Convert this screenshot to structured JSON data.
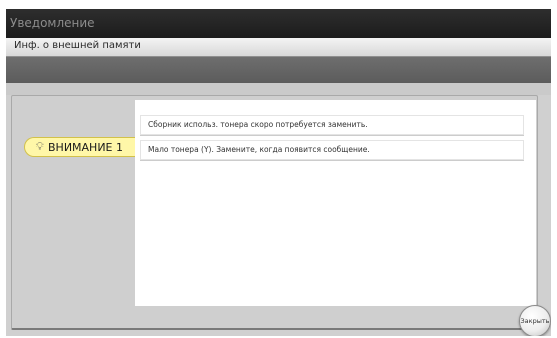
{
  "window": {
    "title": "Уведомление"
  },
  "header": {
    "subtitle": "Инф. о внешней памяти"
  },
  "alert": {
    "tab_label": "ВНИМАНИЕ 1",
    "tab_icon": "bulb-icon",
    "messages": [
      "Сборник использ. тонера скоро потребуется заменить.",
      "Мало тонера (Y). Замените, когда появится сообщение."
    ]
  },
  "buttons": {
    "close_label": "Закрыть"
  },
  "colors": {
    "titlebar": "#262626",
    "tab_background": "#fff7a8",
    "panel": "#cfcfcf"
  }
}
